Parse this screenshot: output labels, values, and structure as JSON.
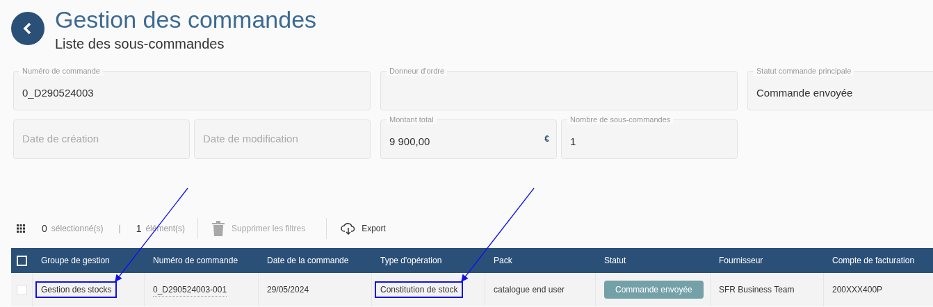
{
  "header": {
    "title": "Gestion des commandes",
    "subtitle": "Liste des sous-commandes"
  },
  "field_rows": [
    [
      {
        "label": "Numéro de commande",
        "value": "0_D290524003"
      },
      {
        "label": "Donneur d'ordre"
      },
      {
        "label": "Statut commande principale",
        "value": "Commande envoyée"
      }
    ],
    [
      {
        "placeholder": "Date de création"
      },
      {
        "placeholder": "Date de modification"
      },
      {
        "label": "Montant total",
        "value": "9 900,00",
        "suffix": "€"
      },
      {
        "label": "Nombre de sous-commandes",
        "value": "1"
      }
    ]
  ],
  "toolbar": {
    "selected_count": "0",
    "selected_label": "sélectionné(s)",
    "separator": "|",
    "element_count": "1",
    "element_label": "élément(s)",
    "clear_filters": {
      "label": "Supprimer les filtres",
      "disabled": true
    },
    "export": {
      "label": "Export",
      "disabled": false
    }
  },
  "table": {
    "select_all_checked": false,
    "columns": [
      "Groupe de gestion",
      "Numéro de commande",
      "Date de la commande",
      "Type d'opération",
      "Pack",
      "Statut",
      "Fournisseur",
      "Compte de facturation"
    ],
    "rows": [
      {
        "checked": false,
        "cells": [
          {
            "kind": "text",
            "text": "Gestion des stocks",
            "highlighted": true
          },
          {
            "kind": "link",
            "text": "0_D290524003-001",
            "highlighted": false
          },
          {
            "kind": "text",
            "text": "29/05/2024",
            "highlighted": false
          },
          {
            "kind": "text",
            "text": "Constitution de stock",
            "highlighted": true
          },
          {
            "kind": "text",
            "text": "catalogue end user",
            "highlighted": false
          },
          {
            "kind": "badge",
            "text": "Commande envoyée",
            "highlighted": false
          },
          {
            "kind": "text",
            "text": "SFR Business Team",
            "highlighted": false
          },
          {
            "kind": "text",
            "text": "200XXX400P",
            "highlighted": false
          }
        ]
      }
    ]
  }
}
